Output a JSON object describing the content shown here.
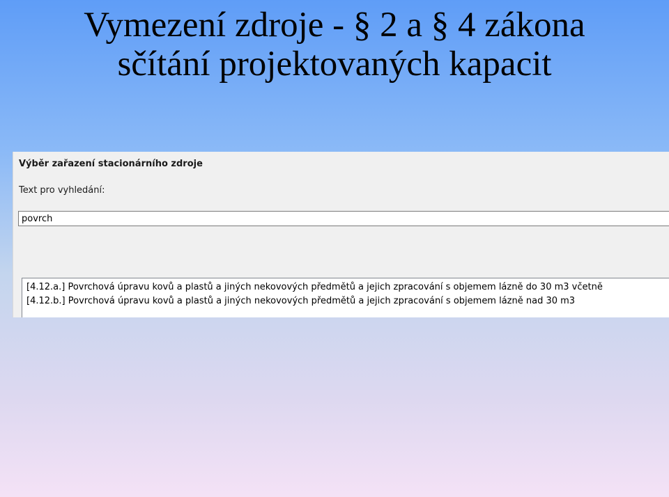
{
  "slide": {
    "title_line1": "Vymezení zdroje - § 2 a § 4 zákona",
    "title_line2": "sčítání projektovaných kapacit"
  },
  "dialog": {
    "heading": "Výběr zařazení stacionárního zdroje",
    "search_label": "Text pro vyhledání:",
    "search_value": "povrch",
    "results": [
      "[4.12.a.] Povrchová úpravu kovů a plastů a jiných nekovových předmětů a jejich zpracování s objemem lázně do 30 m3 včetně",
      "[4.12.b.] Povrchová úpravu kovů a plastů a jiných nekovových předmětů a jejich zpracování s objemem lázně nad 30 m3"
    ]
  }
}
